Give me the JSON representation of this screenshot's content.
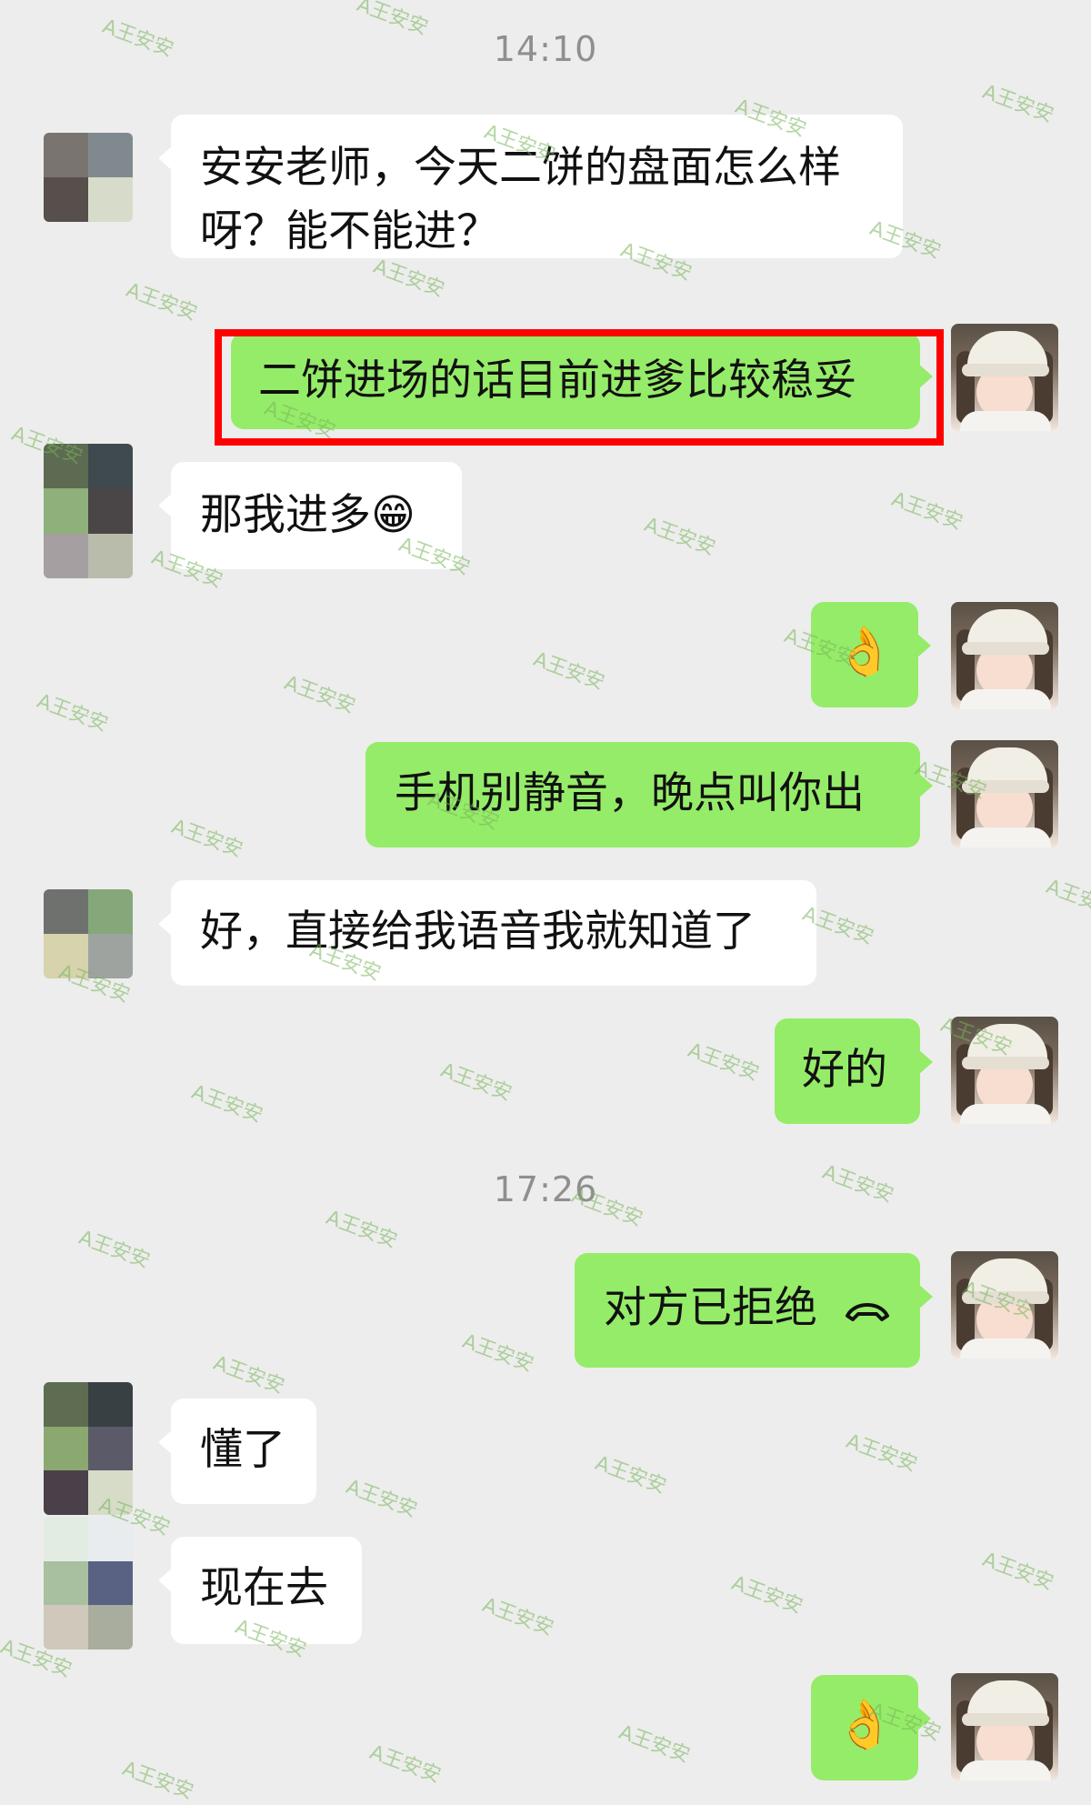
{
  "colors": {
    "background": "#EDEDED",
    "incoming_bubble": "#FFFFFF",
    "outgoing_bubble": "#95EC69",
    "timestamp": "#8F8F8F",
    "highlight": "#FF0000"
  },
  "timestamps": [
    "14:10",
    "17:26"
  ],
  "watermark": "A王安安",
  "messages": [
    {
      "side": "in",
      "text": "安安老师，今天二饼的盘面怎么样呀？能不能进？"
    },
    {
      "side": "out",
      "text": "二饼进场的话目前进爹比较稳妥",
      "highlighted": true
    },
    {
      "side": "in",
      "text": "那我进多",
      "emoji": "😁"
    },
    {
      "side": "out",
      "text": "",
      "emoji": "👌"
    },
    {
      "side": "out",
      "text": "手机别静音，晚点叫你出"
    },
    {
      "side": "in",
      "text": "好，直接给我语音我就知道了"
    },
    {
      "side": "out",
      "text": "好的"
    },
    {
      "side": "out",
      "text": "对方已拒绝",
      "icon": "hangup-icon"
    },
    {
      "side": "in",
      "text": "懂了"
    },
    {
      "side": "in",
      "text": "现在去"
    },
    {
      "side": "out",
      "text": "",
      "emoji": "👌"
    }
  ]
}
